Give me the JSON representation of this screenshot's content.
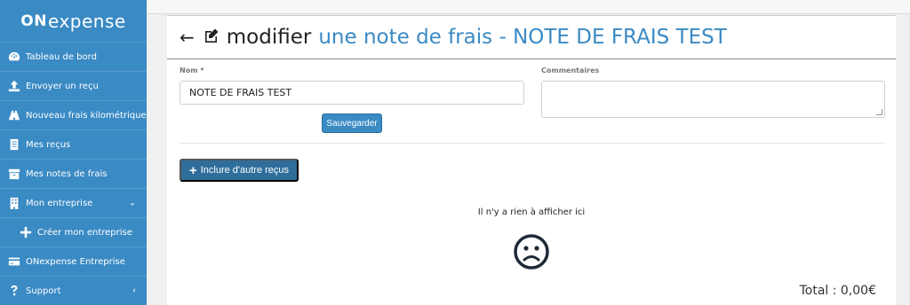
{
  "sidebar": {
    "logo_on": "ON",
    "logo_expense": "expense",
    "items": [
      {
        "label": "Tableau de bord",
        "icon": "dashboard-icon"
      },
      {
        "label": "Envoyer un reçu",
        "icon": "upload-icon"
      },
      {
        "label": "Nouveau frais kilométrique",
        "icon": "road-icon"
      },
      {
        "label": "Mes reçus",
        "icon": "receipt-icon"
      },
      {
        "label": "Mes notes de frais",
        "icon": "archive-icon"
      },
      {
        "label": "Mon entreprise",
        "icon": "building-icon",
        "chevron": "⌄"
      },
      {
        "label": "Créer mon entreprise",
        "icon": "plus-icon"
      },
      {
        "label": "ONexpense Entreprise",
        "icon": "credit-card-icon"
      },
      {
        "label": "Support",
        "icon": "question-icon",
        "chevron": "‹"
      }
    ]
  },
  "header": {
    "back_glyph": "←",
    "title_part1": "modifier",
    "title_part2": "une note de frais - NOTE DE FRAIS TEST"
  },
  "form": {
    "nom_label": "Nom *",
    "nom_value": "NOTE DE FRAIS TEST",
    "comment_label": "Commentaires",
    "comment_value": "",
    "save_label": "Sauvegarder"
  },
  "actions": {
    "include_label": "Inclure d'autre reçus"
  },
  "empty": {
    "text": "Il n'y a rien à afficher ici"
  },
  "total": {
    "text": "Total : 0,00€"
  },
  "colors": {
    "sidebar": "#3a8ac4",
    "accent": "#3a8ac4",
    "button_dark": "#2f6e9a"
  }
}
